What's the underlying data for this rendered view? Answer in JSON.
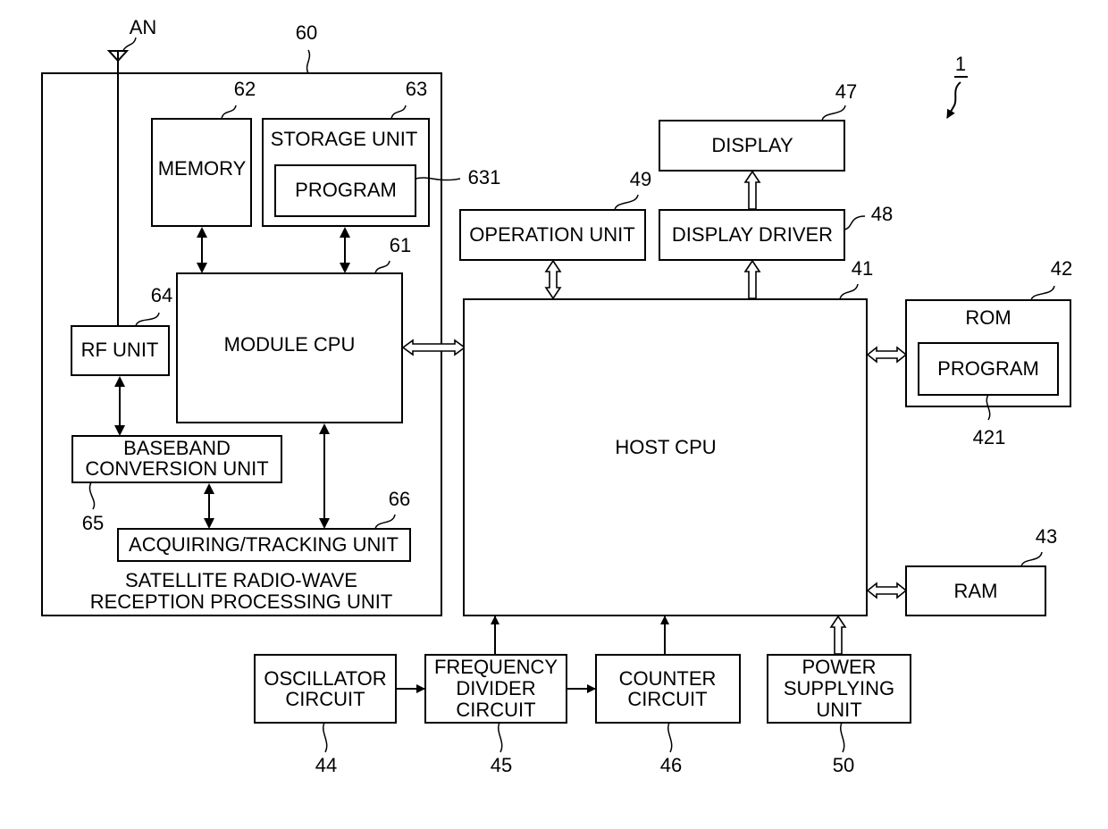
{
  "figure": {
    "reference": "1",
    "antenna_label": "AN"
  },
  "blocks": {
    "module": {
      "ref": "60",
      "caption_line1": "SATELLITE RADIO-WAVE",
      "caption_line2": "RECEPTION PROCESSING UNIT"
    },
    "memory": {
      "ref": "62",
      "label": "MEMORY"
    },
    "storage": {
      "ref": "63",
      "label": "STORAGE UNIT"
    },
    "storage_program": {
      "ref": "631",
      "label": "PROGRAM"
    },
    "module_cpu": {
      "ref": "61",
      "label": "MODULE CPU"
    },
    "rf_unit": {
      "ref": "64",
      "label": "RF UNIT"
    },
    "baseband": {
      "ref": "65",
      "label_line1": "BASEBAND",
      "label_line2": "CONVERSION UNIT"
    },
    "acquiring": {
      "ref": "66",
      "label": "ACQUIRING/TRACKING UNIT"
    },
    "display": {
      "ref": "47",
      "label": "DISPLAY"
    },
    "display_driver": {
      "ref": "48",
      "label": "DISPLAY DRIVER"
    },
    "operation_unit": {
      "ref": "49",
      "label": "OPERATION UNIT"
    },
    "host_cpu": {
      "ref": "41",
      "label": "HOST CPU"
    },
    "rom": {
      "ref": "42",
      "label": "ROM"
    },
    "rom_program": {
      "ref": "421",
      "label": "PROGRAM"
    },
    "ram": {
      "ref": "43",
      "label": "RAM"
    },
    "oscillator": {
      "ref": "44",
      "label_line1": "OSCILLATOR",
      "label_line2": "CIRCUIT"
    },
    "freq_divider": {
      "ref": "45",
      "label_line1": "FREQUENCY",
      "label_line2": "DIVIDER",
      "label_line3": "CIRCUIT"
    },
    "counter": {
      "ref": "46",
      "label_line1": "COUNTER",
      "label_line2": "CIRCUIT"
    },
    "power": {
      "ref": "50",
      "label_line1": "POWER",
      "label_line2": "SUPPLYING",
      "label_line3": "UNIT"
    }
  }
}
